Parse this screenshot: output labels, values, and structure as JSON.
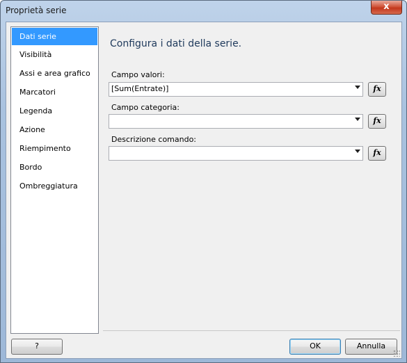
{
  "window": {
    "title": "Proprietà serie",
    "close_glyph": "x"
  },
  "sidebar": {
    "items": [
      {
        "label": "Dati serie"
      },
      {
        "label": "Visibilità"
      },
      {
        "label": "Assi e area grafico"
      },
      {
        "label": "Marcatori"
      },
      {
        "label": "Legenda"
      },
      {
        "label": "Azione"
      },
      {
        "label": "Riempimento"
      },
      {
        "label": "Bordo"
      },
      {
        "label": "Ombreggiatura"
      }
    ],
    "selected": "Dati serie"
  },
  "main": {
    "heading": "Configura i dati della serie.",
    "fields": [
      {
        "label": "Campo valori:",
        "value": "[Sum(Entrate)]",
        "fx_label": "fx"
      },
      {
        "label": "Campo categoria:",
        "value": "",
        "fx_label": "fx"
      },
      {
        "label": "Descrizione comando:",
        "value": "",
        "fx_label": "fx"
      }
    ]
  },
  "footer": {
    "help_label": "?",
    "ok_label": "OK",
    "cancel_label": "Annulla"
  },
  "colors": {
    "selection": "#3399ff",
    "heading": "#1e395b",
    "close": "#c3371c"
  }
}
